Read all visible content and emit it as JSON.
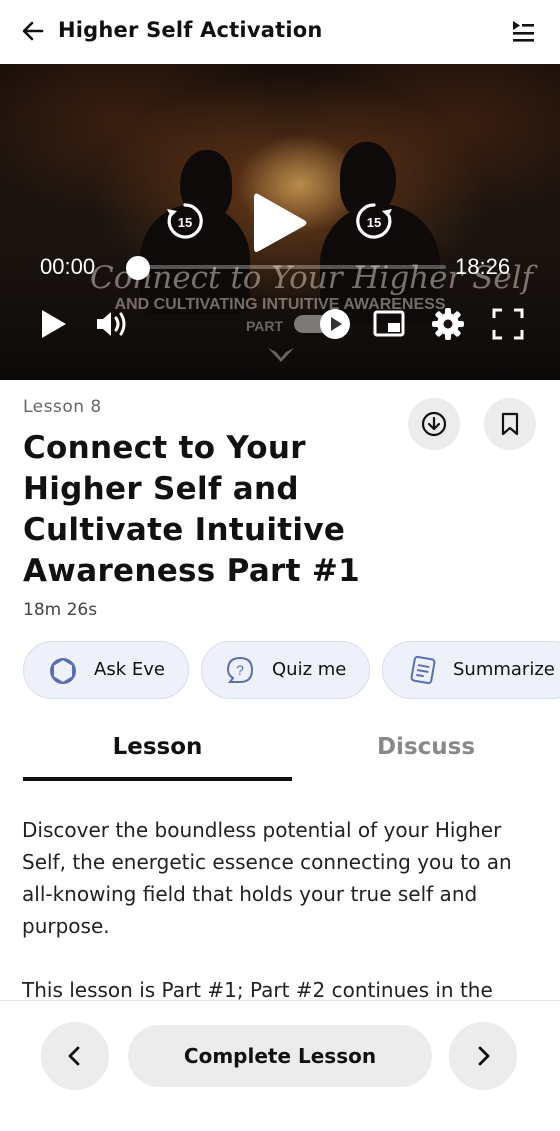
{
  "header": {
    "title": "Higher Self Activation"
  },
  "video": {
    "current_time": "00:00",
    "total_time": "18:26",
    "progress": 0,
    "skip_back_seconds": "15",
    "skip_forward_seconds": "15",
    "overlay_title": "Connect to Your Higher Self",
    "overlay_subtitle": "AND CULTIVATING INTUITIVE AWARENESS",
    "overlay_part": "PART"
  },
  "lesson": {
    "label": "Lesson 8",
    "title": "Connect to Your Higher Self and Cultivate Intuitive Awareness Part #1",
    "duration": "18m 26s"
  },
  "actions": [
    {
      "label": "Ask Eve",
      "icon": "eve-icon"
    },
    {
      "label": "Quiz me",
      "icon": "quiz-icon"
    },
    {
      "label": "Summarize",
      "icon": "summarize-icon"
    }
  ],
  "tabs": [
    {
      "label": "Lesson",
      "active": true
    },
    {
      "label": "Discuss",
      "active": false
    }
  ],
  "body": {
    "paragraphs": [
      "Discover the boundless potential of your Higher Self, the energetic essence connecting you to an all-knowing field that holds your true self and purpose.",
      "This lesson is Part #1; Part #2 continues in the"
    ]
  },
  "footer": {
    "complete_label": "Complete Lesson"
  },
  "colors": {
    "chip_background": "#eef1fa",
    "chip_icon": "#5b6fb0",
    "button_gray": "#ececec",
    "text_primary": "#111111"
  }
}
